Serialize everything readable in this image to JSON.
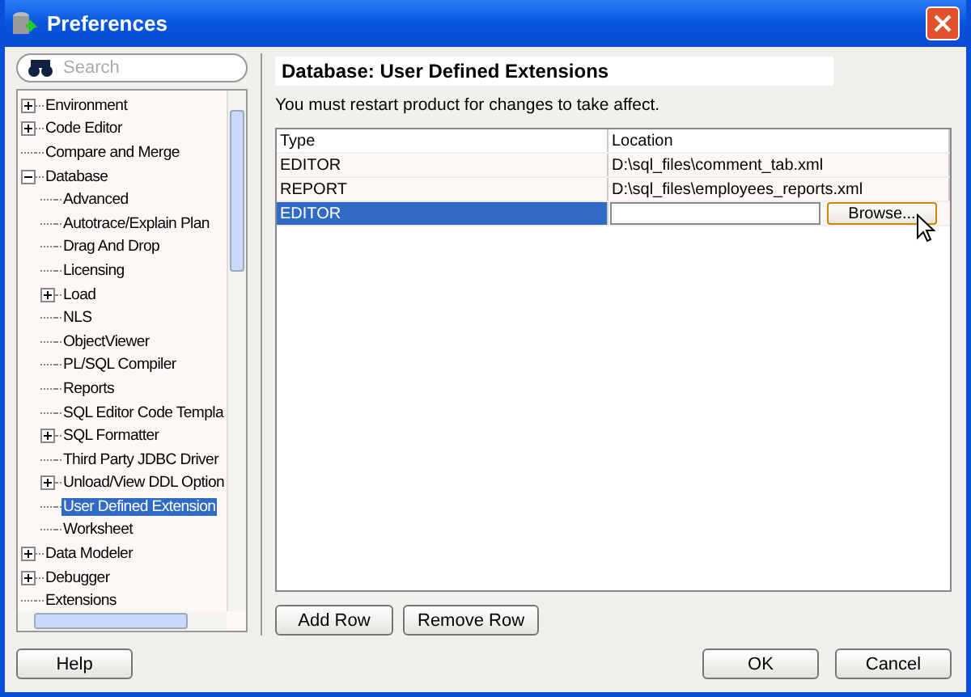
{
  "window": {
    "title": "Preferences"
  },
  "search": {
    "placeholder": "Search"
  },
  "tree": [
    {
      "label": "Environment",
      "expandable": true,
      "expanded": false,
      "selected": false
    },
    {
      "label": "Code Editor",
      "expandable": true,
      "expanded": false,
      "selected": false
    },
    {
      "label": "Compare and Merge",
      "expandable": false,
      "selected": false
    },
    {
      "label": "Database",
      "expandable": true,
      "expanded": true,
      "selected": false,
      "children": [
        {
          "label": "Advanced",
          "expandable": false,
          "selected": false
        },
        {
          "label": "Autotrace/Explain Plan",
          "expandable": false,
          "selected": false
        },
        {
          "label": "Drag And Drop",
          "expandable": false,
          "selected": false
        },
        {
          "label": "Licensing",
          "expandable": false,
          "selected": false
        },
        {
          "label": "Load",
          "expandable": true,
          "expanded": false,
          "selected": false
        },
        {
          "label": "NLS",
          "expandable": false,
          "selected": false
        },
        {
          "label": "ObjectViewer",
          "expandable": false,
          "selected": false
        },
        {
          "label": "PL/SQL Compiler",
          "expandable": false,
          "selected": false
        },
        {
          "label": "Reports",
          "expandable": false,
          "selected": false
        },
        {
          "label": "SQL Editor Code Templa",
          "expandable": false,
          "selected": false
        },
        {
          "label": "SQL Formatter",
          "expandable": true,
          "expanded": false,
          "selected": false
        },
        {
          "label": "Third Party JDBC Driver",
          "expandable": false,
          "selected": false
        },
        {
          "label": "Unload/View DDL Option",
          "expandable": true,
          "expanded": false,
          "selected": false
        },
        {
          "label": "User Defined Extension",
          "expandable": false,
          "selected": true
        },
        {
          "label": "Worksheet",
          "expandable": false,
          "selected": false
        }
      ]
    },
    {
      "label": "Data Modeler",
      "expandable": true,
      "expanded": false,
      "selected": false
    },
    {
      "label": "Debugger",
      "expandable": true,
      "expanded": false,
      "selected": false
    },
    {
      "label": "Extensions",
      "expandable": false,
      "selected": false
    }
  ],
  "help_button": "Help",
  "panel": {
    "heading": "Database: User Defined Extensions",
    "message": "You must restart product for changes to take affect."
  },
  "table": {
    "columns": [
      "Type",
      "Location"
    ],
    "rows": [
      {
        "type": "EDITOR",
        "location": "D:\\sql_files\\comment_tab.xml",
        "selected": false,
        "editing": false
      },
      {
        "type": "REPORT",
        "location": "D:\\sql_files\\employees_reports.xml",
        "selected": false,
        "editing": false
      },
      {
        "type": "EDITOR",
        "selected": true,
        "editing": true,
        "browse_button": "Browse..."
      }
    ]
  },
  "table_buttons": [
    "Add Row",
    "Remove Row"
  ],
  "dialog_buttons": [
    "OK",
    "Cancel"
  ]
}
